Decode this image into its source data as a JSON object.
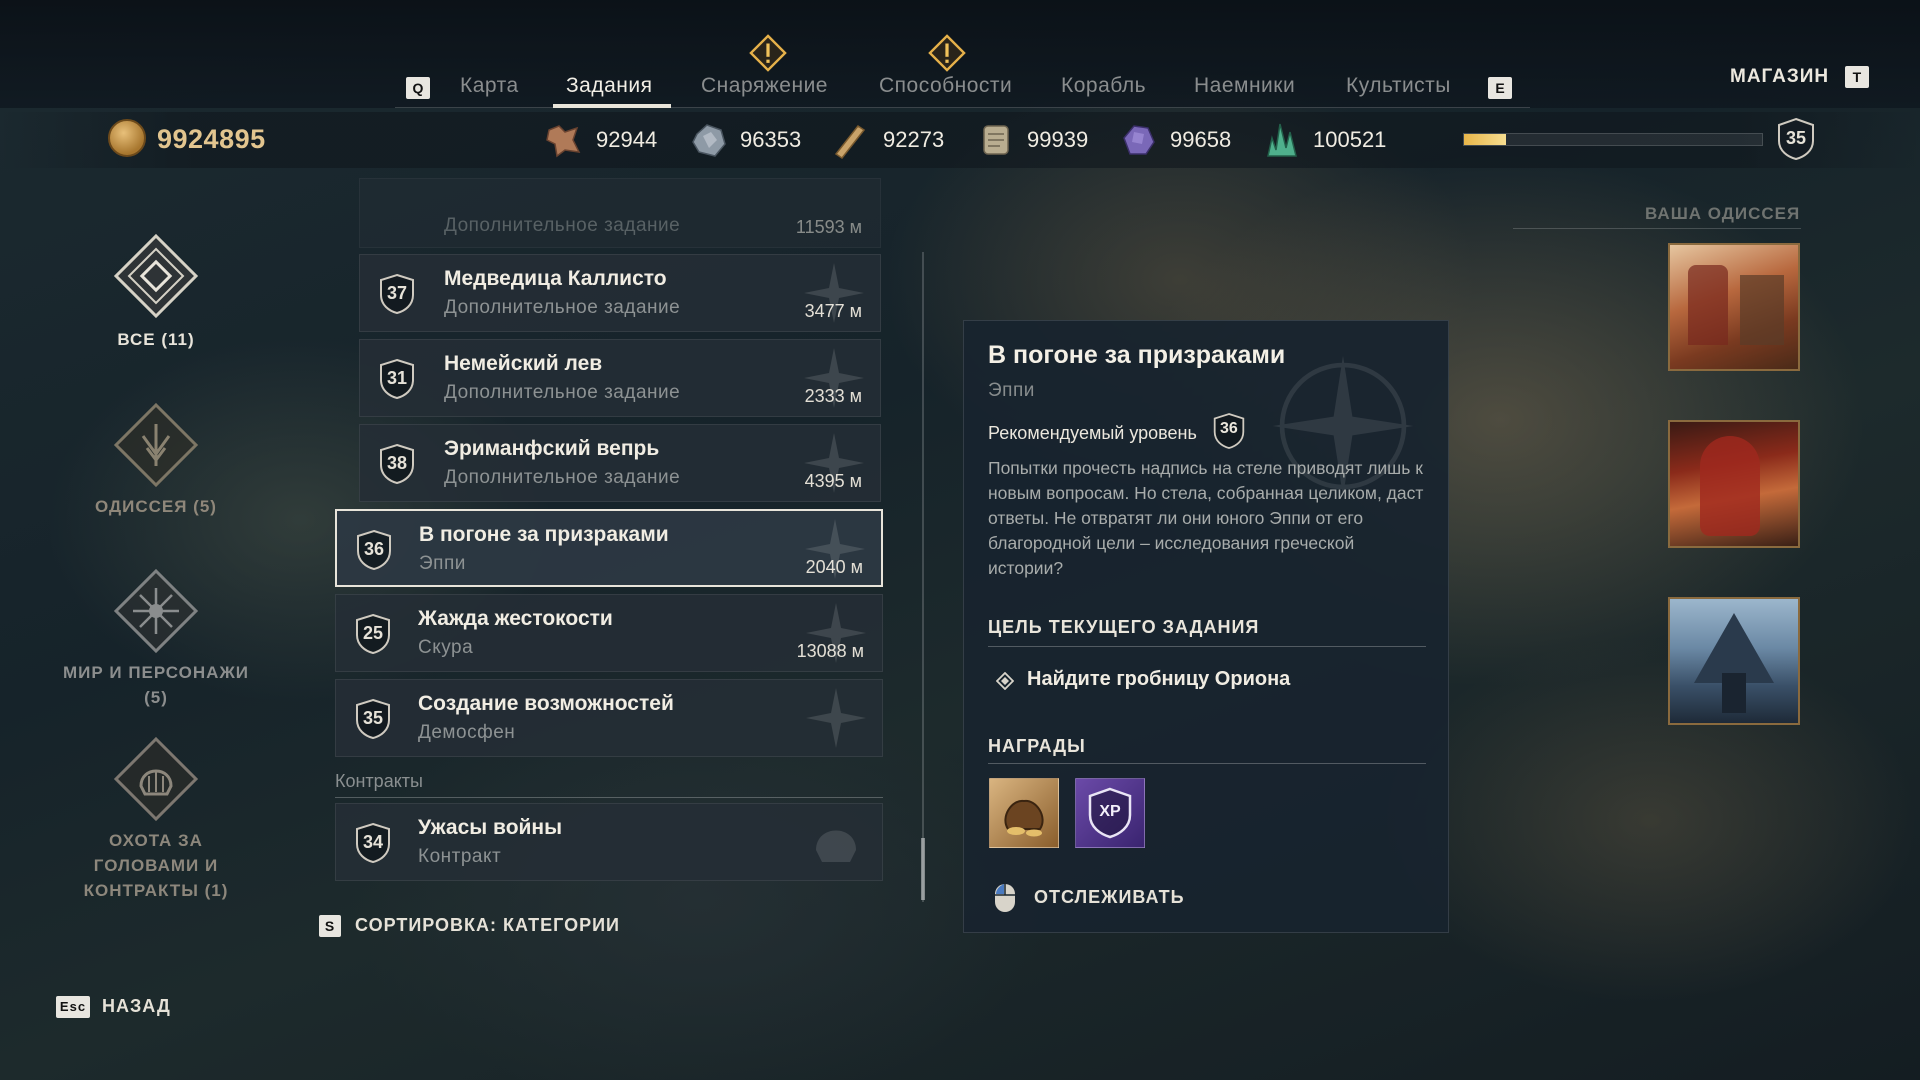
{
  "nav": {
    "key_left": "Q",
    "key_right": "E",
    "tabs": [
      "Карта",
      "Задания",
      "Снаряжение",
      "Способности",
      "Корабль",
      "Наемники",
      "Культисты"
    ],
    "active_tab": "Задания",
    "shop_label": "МАГАЗИН",
    "shop_key": "T"
  },
  "resources": {
    "drachmae": "9924895",
    "items": [
      {
        "icon": "leather-icon",
        "value": "92944"
      },
      {
        "icon": "iron-ore-icon",
        "value": "96353"
      },
      {
        "icon": "wood-icon",
        "value": "92273"
      },
      {
        "icon": "bronze-icon",
        "value": "99939"
      },
      {
        "icon": "obsidian-icon",
        "value": "99658"
      },
      {
        "icon": "crystal-icon",
        "value": "100521"
      }
    ],
    "xp_progress": 0.14,
    "level": "35"
  },
  "categories": [
    {
      "label": "ВСЕ (11)",
      "icon": "all-quests-icon",
      "active": true
    },
    {
      "label": "ОДИССЕЯ (5)",
      "icon": "odyssey-icon",
      "active": false
    },
    {
      "label": "МИР И ПЕРСОНАЖИ (5)",
      "icon": "world-characters-icon",
      "active": false
    },
    {
      "label": "ОХОТА ЗА ГОЛОВАМИ И КОНТРАКТЫ (1)",
      "icon": "bounties-contracts-icon",
      "active": false
    }
  ],
  "quests": {
    "partial_top": {
      "title": "Дополнительное задание",
      "distance": "11593 м"
    },
    "items": [
      {
        "level": "37",
        "title": "Медведица Каллисто",
        "subtitle": "Дополнительное задание",
        "distance": "3477 м"
      },
      {
        "level": "31",
        "title": "Немейский лев",
        "subtitle": "Дополнительное задание",
        "distance": "2333 м"
      },
      {
        "level": "38",
        "title": "Эриманфский вепрь",
        "subtitle": "Дополнительное задание",
        "distance": "4395 м"
      },
      {
        "level": "36",
        "title": "В погоне за призраками",
        "subtitle": "Эппи",
        "distance": "2040 м"
      },
      {
        "level": "25",
        "title": "Жажда жестокости",
        "subtitle": "Скура",
        "distance": "13088 м"
      },
      {
        "level": "35",
        "title": "Создание возможностей",
        "subtitle": "Демосфен",
        "distance": ""
      }
    ],
    "contracts_label": "Контракты",
    "contracts": [
      {
        "level": "34",
        "title": "Ужасы войны",
        "subtitle": "Контракт"
      }
    ],
    "sort_key": "S",
    "sort_label": "СОРТИРОВКА: КАТЕГОРИИ"
  },
  "detail": {
    "title": "В погоне за призраками",
    "giver": "Эппи",
    "recommended_label": "Рекомендуемый уровень",
    "recommended_level": "36",
    "description": "Попытки прочесть надпись на стеле приводят лишь к новым вопросам. Но стела, собранная целиком, даст ответы. Не отвратят ли они юного Эппи от его благородной цели – исследования греческой истории?",
    "objective_header": "ЦЕЛЬ ТЕКУЩЕГО ЗАДАНИЯ",
    "objective": "Найдите гробницу Ориона",
    "rewards_header": "НАГРАДЫ",
    "rewards": [
      {
        "icon": "drachmae-pouch-icon"
      },
      {
        "icon": "xp-icon",
        "label": "XP"
      }
    ],
    "track_label": "ОТСЛЕЖИВАТЬ"
  },
  "odyssey": {
    "label": "ВАША ОДИССЕЯ"
  },
  "footer": {
    "back_key": "Esc",
    "back_label": "НАЗАД"
  }
}
